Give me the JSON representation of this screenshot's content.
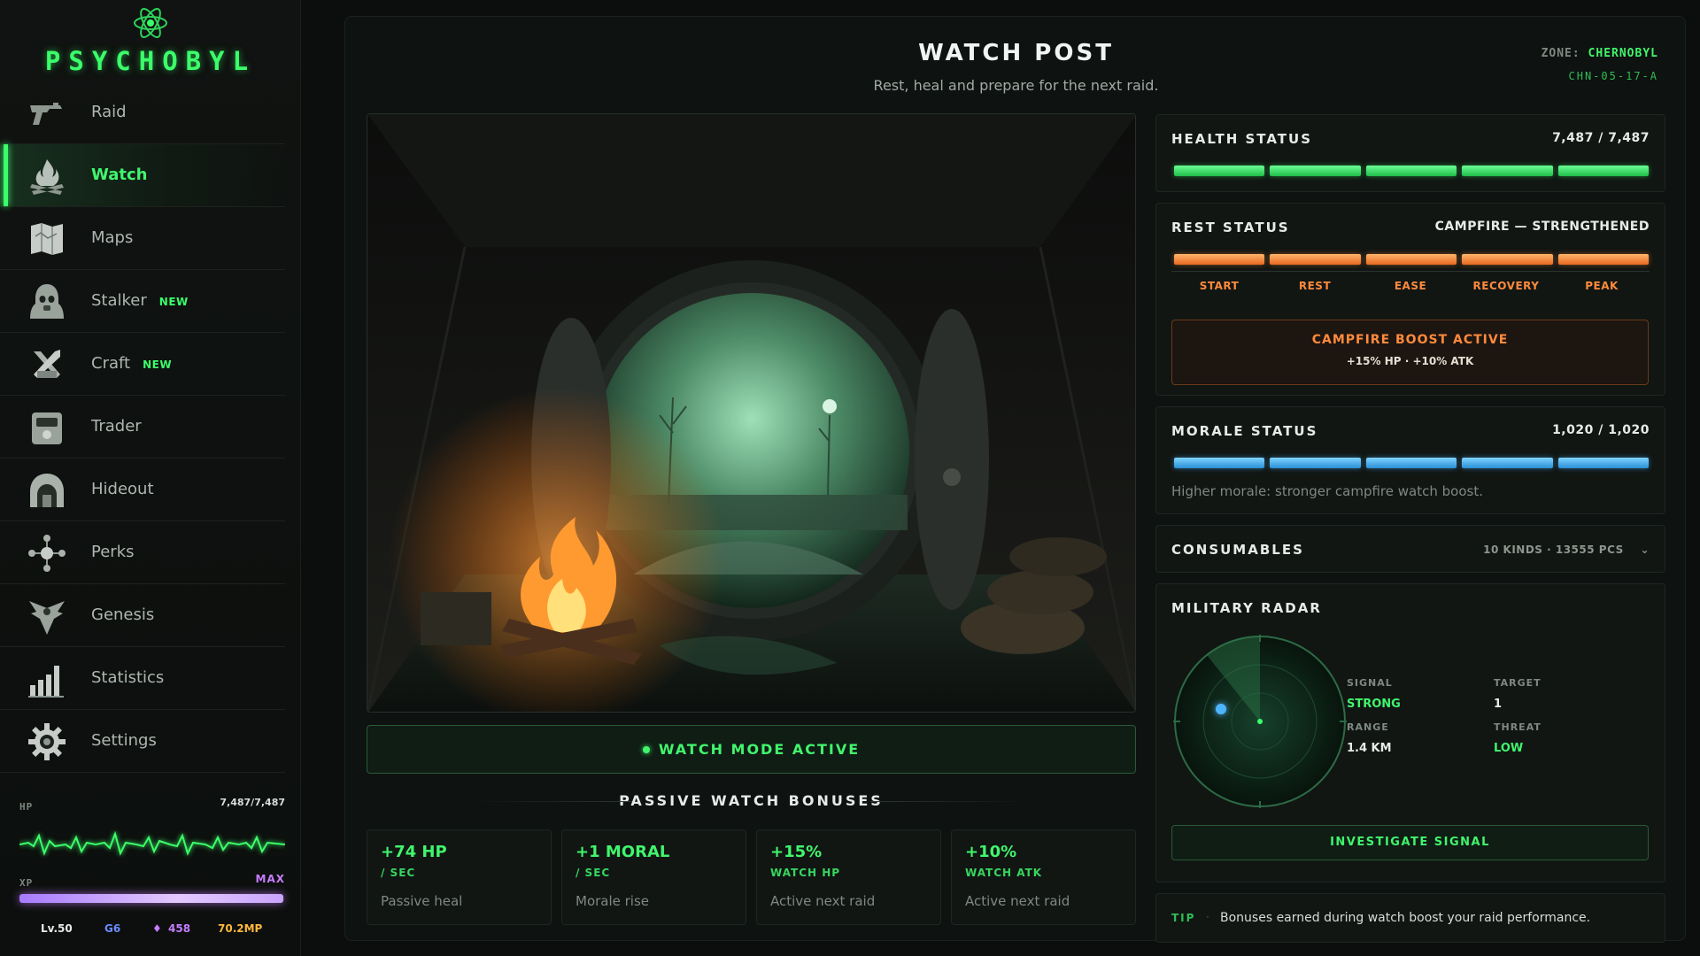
{
  "app": {
    "logo": "PSYCHOBYL"
  },
  "sidebar": {
    "items": [
      {
        "label": "Raid",
        "icon": "pistol-icon",
        "badge": ""
      },
      {
        "label": "Watch",
        "icon": "campfire-icon",
        "badge": "",
        "active": true
      },
      {
        "label": "Maps",
        "icon": "map-icon",
        "badge": ""
      },
      {
        "label": "Stalker",
        "icon": "stalker-icon",
        "badge": "NEW"
      },
      {
        "label": "Craft",
        "icon": "craft-icon",
        "badge": "NEW"
      },
      {
        "label": "Trader",
        "icon": "trader-icon",
        "badge": ""
      },
      {
        "label": "Hideout",
        "icon": "hideout-icon",
        "badge": ""
      },
      {
        "label": "Perks",
        "icon": "perks-icon",
        "badge": ""
      },
      {
        "label": "Genesis",
        "icon": "genesis-icon",
        "badge": ""
      },
      {
        "label": "Statistics",
        "icon": "statistics-icon",
        "badge": ""
      },
      {
        "label": "Settings",
        "icon": "gear-icon",
        "badge": ""
      }
    ],
    "vitals": {
      "hp_label": "HP",
      "hp_value": "7,487/7,487",
      "xp_label": "XP",
      "xp_value": "MAX",
      "level": "Lv.50",
      "g": "G6",
      "gems": "458",
      "mp": "70.2MP"
    }
  },
  "header": {
    "title": "WATCH POST",
    "subtitle": "Rest, heal and prepare for the next raid.",
    "zone_label": "ZONE:",
    "zone_value": "CHERNOBYL",
    "zone_code": "CHN-05-17-A"
  },
  "main": {
    "watch_mode_label": "WATCH MODE ACTIVE",
    "bonuses_title": "PASSIVE WATCH BONUSES",
    "bonuses": [
      {
        "value": "+74 HP",
        "unit": "/ SEC",
        "desc": "Passive heal"
      },
      {
        "value": "+1 MORAL",
        "unit": "/ SEC",
        "desc": "Morale rise"
      },
      {
        "value": "+15%",
        "unit": "WATCH HP",
        "desc": "Active next raid"
      },
      {
        "value": "+10%",
        "unit": "WATCH ATK",
        "desc": "Active next raid"
      }
    ]
  },
  "health": {
    "title": "HEALTH STATUS",
    "value": "7,487 / 7,487",
    "fraction": 1.0
  },
  "rest": {
    "title": "REST STATUS",
    "value": "CAMPFIRE — STRENGTHENED",
    "stages": [
      "START",
      "REST",
      "EASE",
      "RECOVERY",
      "PEAK"
    ],
    "boost_title": "CAMPFIRE BOOST ACTIVE",
    "boost_detail": "+15% HP · +10% ATK"
  },
  "morale": {
    "title": "MORALE STATUS",
    "value": "1,020 / 1,020",
    "note": "Higher morale: stronger campfire watch boost.",
    "fraction": 1.0
  },
  "consumables": {
    "title": "CONSUMABLES",
    "summary": "10 KINDS · 13555 PCS"
  },
  "radar": {
    "title": "MILITARY RADAR",
    "signal_label": "SIGNAL",
    "signal_value": "STRONG",
    "target_label": "TARGET",
    "target_value": "1",
    "range_label": "RANGE",
    "range_value": "1.4 KM",
    "threat_label": "THREAT",
    "threat_value": "LOW",
    "button": "INVESTIGATE SIGNAL"
  },
  "tip": {
    "label": "TIP",
    "text": "Bonuses earned during watch boost your raid performance."
  },
  "colors": {
    "accent": "#41f56d",
    "orange": "#ff8a3d",
    "blue": "#4fb4ff",
    "purple": "#c77dff"
  }
}
